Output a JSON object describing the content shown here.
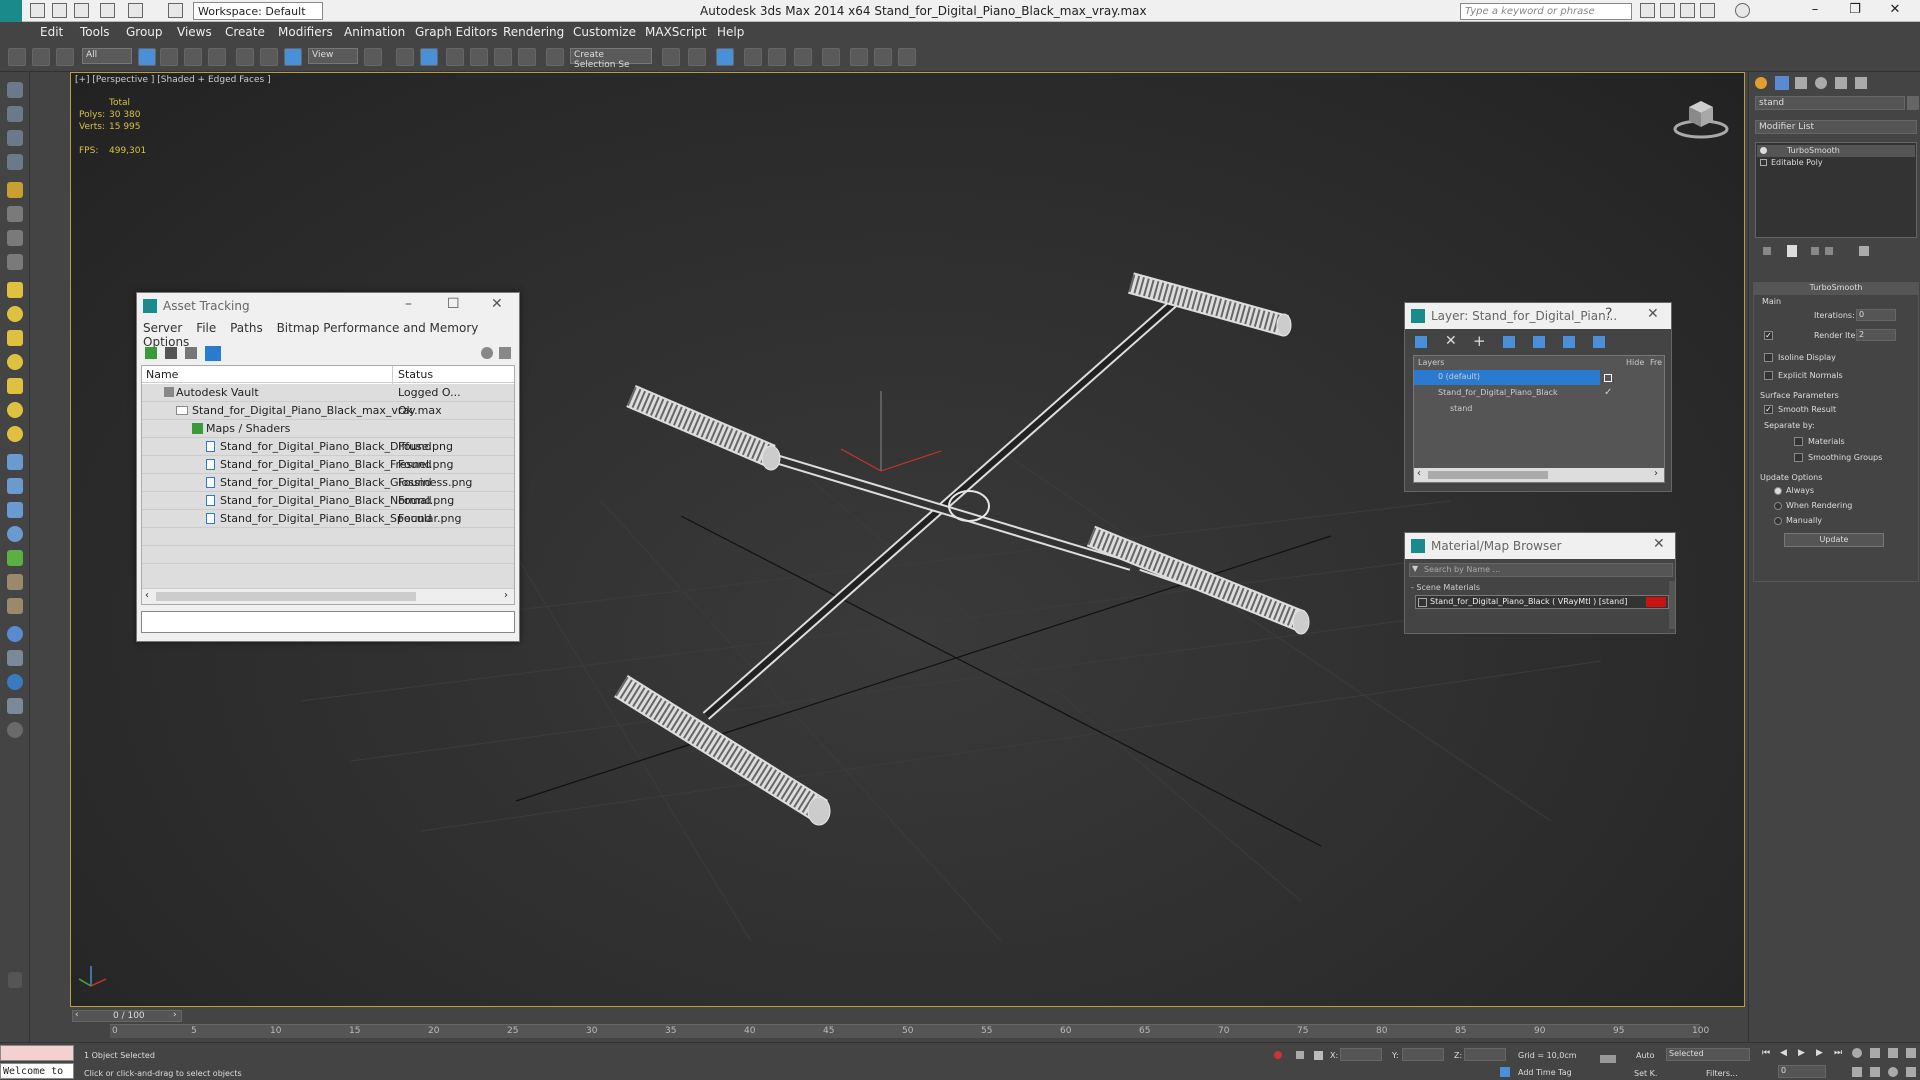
{
  "window": {
    "title": "Autodesk 3ds Max  2014 x64     Stand_for_Digital_Piano_Black_max_vray.max",
    "workspace": "Workspace: Default",
    "search_placeholder": "Type a keyword or phrase"
  },
  "menu": [
    "Edit",
    "Tools",
    "Group",
    "Views",
    "Create",
    "Modifiers",
    "Animation",
    "Graph Editors",
    "Rendering",
    "Customize",
    "MAXScript",
    "Help"
  ],
  "toolbar": {
    "filter": "All",
    "refcoord": "View",
    "named_sel": "Create Selection Se"
  },
  "viewport": {
    "label": "[+] [Perspective ] [Shaded + Edged Faces ]",
    "stats_header": "Total",
    "polys_label": "Polys:",
    "polys": "30 380",
    "verts_label": "Verts:",
    "verts": "15 995",
    "fps_label": "FPS:",
    "fps": "499,301"
  },
  "asset_tracking": {
    "title": "Asset Tracking",
    "menu": [
      "Server",
      "File",
      "Paths",
      "Bitmap Performance and Memory",
      "Options"
    ],
    "col_name": "Name",
    "col_status": "Status",
    "rows": [
      {
        "name": "Autodesk Vault",
        "status": "Logged O..."
      },
      {
        "name": "Stand_for_Digital_Piano_Black_max_vray.max",
        "status": "Ok"
      },
      {
        "name": "Maps / Shaders",
        "status": ""
      },
      {
        "name": "Stand_for_Digital_Piano_Black_Diffuse.png",
        "status": "Found"
      },
      {
        "name": "Stand_for_Digital_Piano_Black_Fresnel.png",
        "status": "Found"
      },
      {
        "name": "Stand_for_Digital_Piano_Black_Glossiness.png",
        "status": "Found"
      },
      {
        "name": "Stand_for_Digital_Piano_Black_Normal.png",
        "status": "Found"
      },
      {
        "name": "Stand_for_Digital_Piano_Black_Specular.png",
        "status": "Found"
      }
    ]
  },
  "layer_window": {
    "title": "Layer: Stand_for_Digital_Pian...",
    "col_layers": "Layers",
    "col_hide": "Hide",
    "col_freeze": "Fre",
    "rows": [
      "0 (default)",
      "Stand_for_Digital_Piano_Black",
      "stand"
    ]
  },
  "material_browser": {
    "title": "Material/Map Browser",
    "search_placeholder": "Search by Name ...",
    "section": "- Scene Materials",
    "item": "Stand_for_Digital_Piano_Black  ( VRayMtl ) [stand]",
    "swatch_color": "#cc1111"
  },
  "command_panel": {
    "object_name": "stand",
    "modifier_list": "Modifier List",
    "stack": [
      "TurboSmooth",
      "Editable Poly"
    ],
    "rollout_title": "TurboSmooth",
    "main": "Main",
    "iterations_label": "Iterations:",
    "iterations": "0",
    "render_iters_label": "Render Iters:",
    "render_iters": "2",
    "isoline": "Isoline Display",
    "explicit_normals": "Explicit Normals",
    "surface_params": "Surface Parameters",
    "smooth_result": "Smooth Result",
    "separate_by": "Separate by:",
    "materials": "Materials",
    "smoothing_groups": "Smoothing Groups",
    "update_options": "Update Options",
    "always": "Always",
    "when_rendering": "When Rendering",
    "manually": "Manually",
    "update_btn": "Update"
  },
  "timeline": {
    "frame": "0 / 100",
    "ticks": [
      "0",
      "5",
      "10",
      "15",
      "20",
      "25",
      "30",
      "35",
      "40",
      "45",
      "50",
      "55",
      "60",
      "65",
      "70",
      "75",
      "80",
      "85",
      "90",
      "95",
      "100"
    ]
  },
  "status": {
    "welcome": "Welcome to",
    "selected": "1 Object Selected",
    "prompt": "Click or click-and-drag to select objects",
    "x_label": "X:",
    "y_label": "Y:",
    "z_label": "Z:",
    "grid": "Grid = 10,0cm",
    "add_time_tag": "Add Time Tag",
    "auto": "Auto",
    "set_key": "Set K.",
    "selected_mode": "Selected",
    "filters": "Filters...",
    "frame_field": "0"
  },
  "colors": {
    "accent": "#4a90d9",
    "viewport_border": "#b8a040",
    "stats": "#d8c040"
  }
}
